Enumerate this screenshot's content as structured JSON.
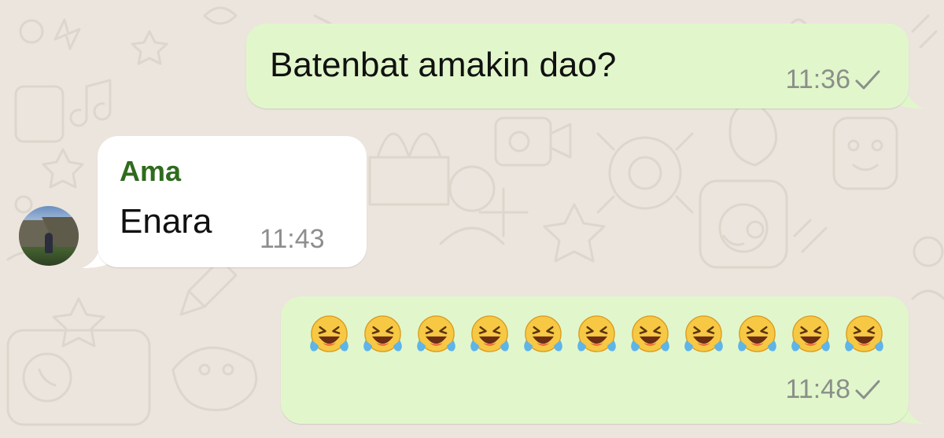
{
  "conversation": {
    "messages": [
      {
        "direction": "outgoing",
        "text": "Batenbat amakin dao?",
        "time": "11:36",
        "status_icon": "single-check-icon"
      },
      {
        "direction": "incoming",
        "sender": "Ama",
        "text": "Enara",
        "time": "11:43",
        "avatar": "profile-photo-mountain-hiker"
      },
      {
        "direction": "outgoing",
        "text": "🤣🤣🤣🤣🤣🤣🤣🤣🤣🤣🤣",
        "emoji_name": "rolling-on-the-floor-laughing-emoji",
        "emoji_count": 11,
        "time": "11:48",
        "status_icon": "single-check-icon"
      }
    ]
  },
  "colors": {
    "wallpaper": "#ece5dd",
    "outgoing_bubble": "#e1f7cb",
    "incoming_bubble": "#ffffff",
    "sender_name": "#2f6b1e",
    "timestamp": "#8b8f8a"
  }
}
